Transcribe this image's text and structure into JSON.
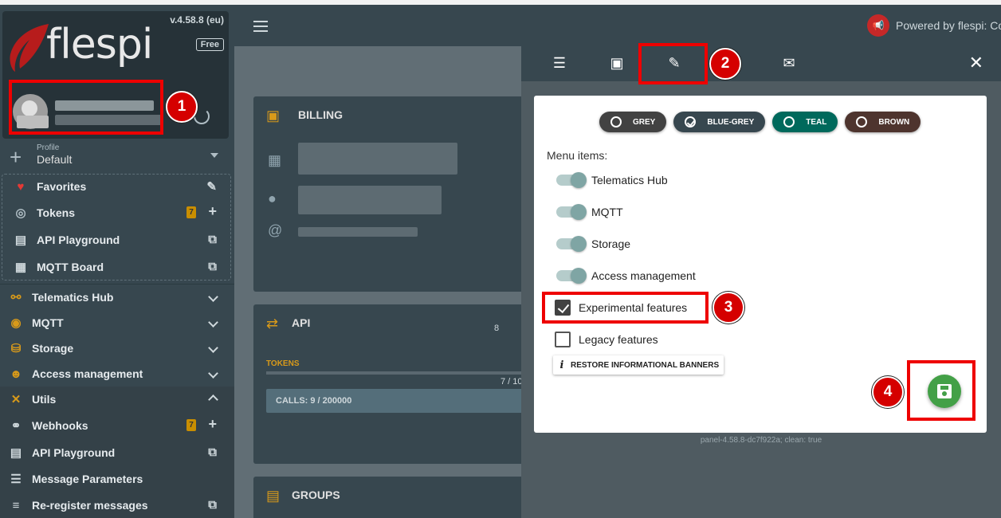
{
  "brand": {
    "logo_text": "flespi",
    "version": "v.4.58.8 (eu)",
    "plan": "Free"
  },
  "profile": {
    "label": "Profile",
    "value": "Default"
  },
  "sidebar": {
    "favorites": [
      {
        "label": "Favorites",
        "icon": "heart-icon"
      },
      {
        "label": "Tokens",
        "icon": "fingerprint-icon",
        "badge": "7"
      },
      {
        "label": "API Playground",
        "icon": "book-icon"
      },
      {
        "label": "MQTT Board",
        "icon": "board-icon"
      }
    ],
    "sections": [
      {
        "label": "Telematics Hub",
        "icon": "hub-icon"
      },
      {
        "label": "MQTT",
        "icon": "antenna-icon"
      },
      {
        "label": "Storage",
        "icon": "database-icon"
      },
      {
        "label": "Access management",
        "icon": "users-icon"
      },
      {
        "label": "Utils",
        "icon": "tools-icon"
      }
    ],
    "utils": [
      {
        "label": "Webhooks",
        "icon": "webhook-icon",
        "badge": "7"
      },
      {
        "label": "API Playground",
        "icon": "book-icon"
      },
      {
        "label": "Message Parameters",
        "icon": "list-icon"
      },
      {
        "label": "Re-register messages",
        "icon": "reregister-icon"
      }
    ]
  },
  "topbar": {
    "powered": "Powered by flespi: Co"
  },
  "cards": {
    "billing": {
      "title": "BILLING"
    },
    "api": {
      "title": "API",
      "tokens_label": "TOKENS",
      "tokens_count": "7 / 10",
      "calls": "CALLS: 9 / 200000",
      "side_num": "8"
    },
    "groups": {
      "title": "GROUPS"
    }
  },
  "panel": {
    "themes": [
      {
        "label": "GREY",
        "color": "#424242",
        "checked": false
      },
      {
        "label": "BLUE-GREY",
        "color": "#37474f",
        "checked": true
      },
      {
        "label": "TEAL",
        "color": "#00695c",
        "checked": false
      },
      {
        "label": "BROWN",
        "color": "#4e342e",
        "checked": false
      }
    ],
    "menu_items_label": "Menu items:",
    "toggles": [
      "Telematics Hub",
      "MQTT",
      "Storage",
      "Access management"
    ],
    "experimental": "Experimental features",
    "legacy": "Legacy features",
    "restore": "RESTORE INFORMATIONAL BANNERS",
    "build": "panel-4.58.8-dc7f922a; clean: true"
  },
  "steps": [
    "1",
    "2",
    "3",
    "4"
  ],
  "colors": {
    "highlight": "#e00000",
    "accent": "#d89a1a",
    "save": "#43a047"
  }
}
